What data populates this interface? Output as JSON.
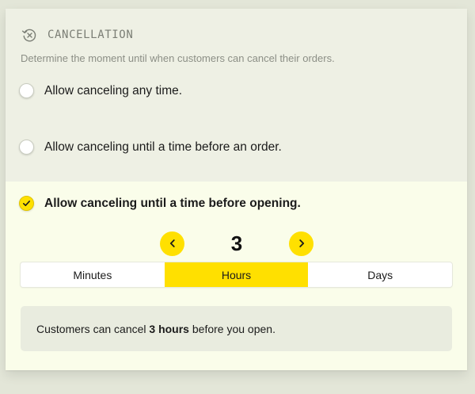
{
  "section": {
    "title": "CANCELLATION",
    "icon": "cancel-clock-icon",
    "description": "Determine the moment until when customers can cancel their orders."
  },
  "options": [
    {
      "label": "Allow canceling any time.",
      "checked": false
    },
    {
      "label": "Allow canceling until a time before an order.",
      "checked": false
    },
    {
      "label": "Allow canceling until a time before opening.",
      "checked": true
    }
  ],
  "stepper": {
    "value": "3",
    "prev_icon": "chevron-left-icon",
    "next_icon": "chevron-right-icon"
  },
  "units": {
    "items": [
      "Minutes",
      "Hours",
      "Days"
    ],
    "selected": "Hours"
  },
  "summary": {
    "prefix": "Customers can cancel ",
    "highlight": "3 hours",
    "suffix": " before you open."
  },
  "colors": {
    "accent": "#ffe000",
    "page_background": "#e3e6d8",
    "card_background": "#eef0e4",
    "selected_background": "#fafdea"
  }
}
